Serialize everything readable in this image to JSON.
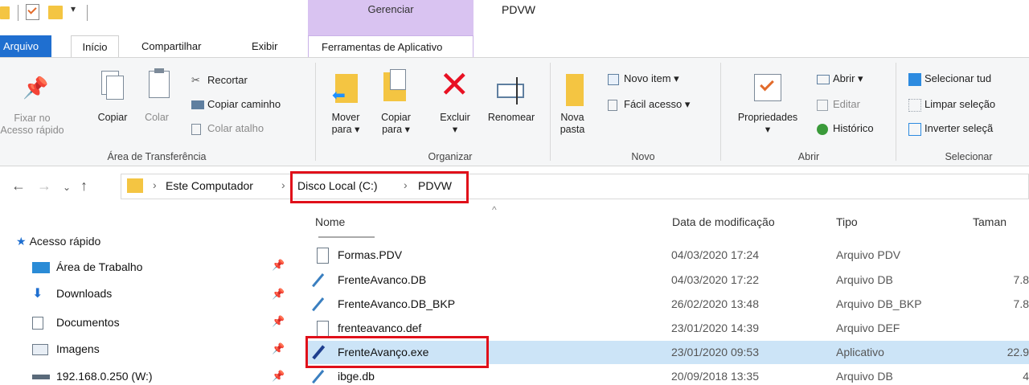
{
  "window": {
    "title": "PDVW",
    "context_tab_group": "Gerenciar",
    "context_tab": "Ferramentas de Aplicativo"
  },
  "ribbon_tabs": [
    "Arquivo",
    "Início",
    "Compartilhar",
    "Exibir"
  ],
  "ribbon": {
    "clipboard": {
      "label": "Área de Transferência",
      "pin": "Fixar no Acesso rápido",
      "pin_line1": "Fixar no",
      "pin_line2": "Acesso rápido",
      "copy": "Copiar",
      "paste": "Colar",
      "cut": "Recortar",
      "copy_path": "Copiar caminho",
      "paste_shortcut": "Colar atalho"
    },
    "organize": {
      "label": "Organizar",
      "move_line1": "Mover",
      "move_line2": "para ▾",
      "copy_line1": "Copiar",
      "copy_line2": "para ▾",
      "delete": "Excluir",
      "delete_arrow": "▾",
      "rename": "Renomear"
    },
    "new": {
      "label": "Novo",
      "new_folder_line1": "Nova",
      "new_folder_line2": "pasta",
      "new_item": "Novo item ▾",
      "easy_access": "Fácil acesso ▾"
    },
    "open": {
      "label": "Abrir",
      "properties": "Propriedades",
      "properties_arrow": "▾",
      "open": "Abrir ▾",
      "edit": "Editar",
      "history": "Histórico"
    },
    "select": {
      "label": "Selecionar",
      "select_all": "Selecionar tud",
      "clear": "Limpar seleção",
      "invert": "Inverter seleçã"
    }
  },
  "address": {
    "crumbs": [
      "Este Computador",
      "Disco Local (C:)",
      "PDVW"
    ],
    "separator": "›"
  },
  "nav": {
    "quick_access": "Acesso rápido",
    "items": [
      {
        "label": "Área de Trabalho",
        "icon": "desktop-icon"
      },
      {
        "label": "Downloads",
        "icon": "downloads-icon"
      },
      {
        "label": "Documentos",
        "icon": "documents-icon"
      },
      {
        "label": "Imagens",
        "icon": "images-icon"
      },
      {
        "label": "192.168.0.250 (W:)",
        "icon": "network-drive-icon"
      }
    ]
  },
  "columns": {
    "name": "Nome",
    "date": "Data de modificação",
    "type": "Tipo",
    "size": "Taman"
  },
  "files": [
    {
      "name": "Formas.PDV",
      "date": "04/03/2020 17:24",
      "type": "Arquivo PDV",
      "size": "",
      "icon": "file-icon"
    },
    {
      "name": "FrenteAvanco.DB",
      "date": "04/03/2020 17:22",
      "type": "Arquivo DB",
      "size": "7.8",
      "icon": "db-file-icon"
    },
    {
      "name": "FrenteAvanco.DB_BKP",
      "date": "26/02/2020 13:48",
      "type": "Arquivo DB_BKP",
      "size": "7.8",
      "icon": "db-file-icon"
    },
    {
      "name": "frenteavanco.def",
      "date": "23/01/2020 14:39",
      "type": "Arquivo DEF",
      "size": "",
      "icon": "file-icon"
    },
    {
      "name": "FrenteAvanço.exe",
      "date": "23/01/2020 09:53",
      "type": "Aplicativo",
      "size": "22.9",
      "icon": "app-icon",
      "selected": true
    },
    {
      "name": "ibge.db",
      "date": "20/09/2018 13:35",
      "type": "Arquivo DB",
      "size": "4",
      "icon": "db-file-icon"
    }
  ],
  "colors": {
    "accent": "#1f6fd0",
    "context_tab": "#d9c3f1",
    "selection": "#cce4f7",
    "highlight": "#e0101a"
  }
}
